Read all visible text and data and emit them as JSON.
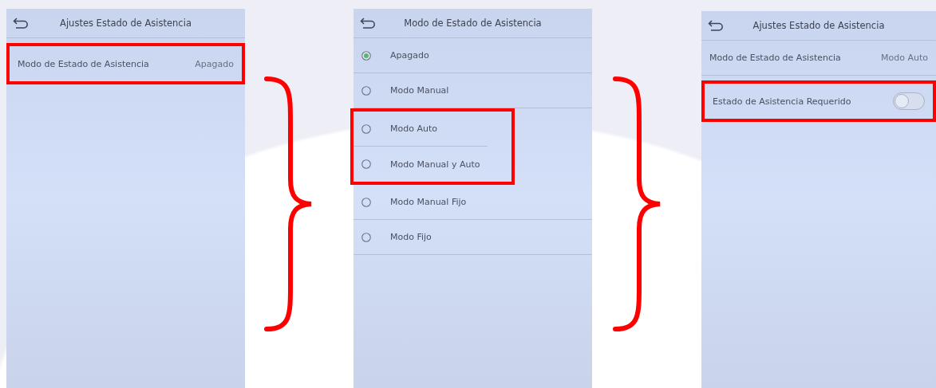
{
  "screens": [
    {
      "kind": "settings",
      "title": "Ajustes Estado de Asistencia",
      "rows": [
        {
          "kind": "value",
          "label": "Modo de Estado de Asistencia",
          "value": "Apagado",
          "highlighted": true
        }
      ]
    },
    {
      "kind": "list",
      "title": "Modo de Estado de Asistencia",
      "rows": [
        {
          "kind": "radio",
          "label": "Apagado",
          "selected": true,
          "highlighted": false
        },
        {
          "kind": "radio",
          "label": "Modo Manual",
          "selected": false,
          "highlighted": false
        },
        {
          "kind": "radio",
          "label": "Modo Auto",
          "selected": false,
          "highlighted": true
        },
        {
          "kind": "radio",
          "label": "Modo Manual y Auto",
          "selected": false,
          "highlighted": true
        },
        {
          "kind": "radio",
          "label": "Modo Manual Fijo",
          "selected": false,
          "highlighted": false
        },
        {
          "kind": "radio",
          "label": "Modo Fijo",
          "selected": false,
          "highlighted": false
        }
      ]
    },
    {
      "kind": "settings",
      "title": "Ajustes Estado de Asistencia",
      "rows": [
        {
          "kind": "value",
          "label": "Modo de Estado de Asistencia",
          "value": "Modo Auto",
          "highlighted": false
        },
        {
          "kind": "toggle",
          "label": "Estado de Asistencia Requerido",
          "on": false,
          "highlighted": true
        }
      ]
    }
  ]
}
